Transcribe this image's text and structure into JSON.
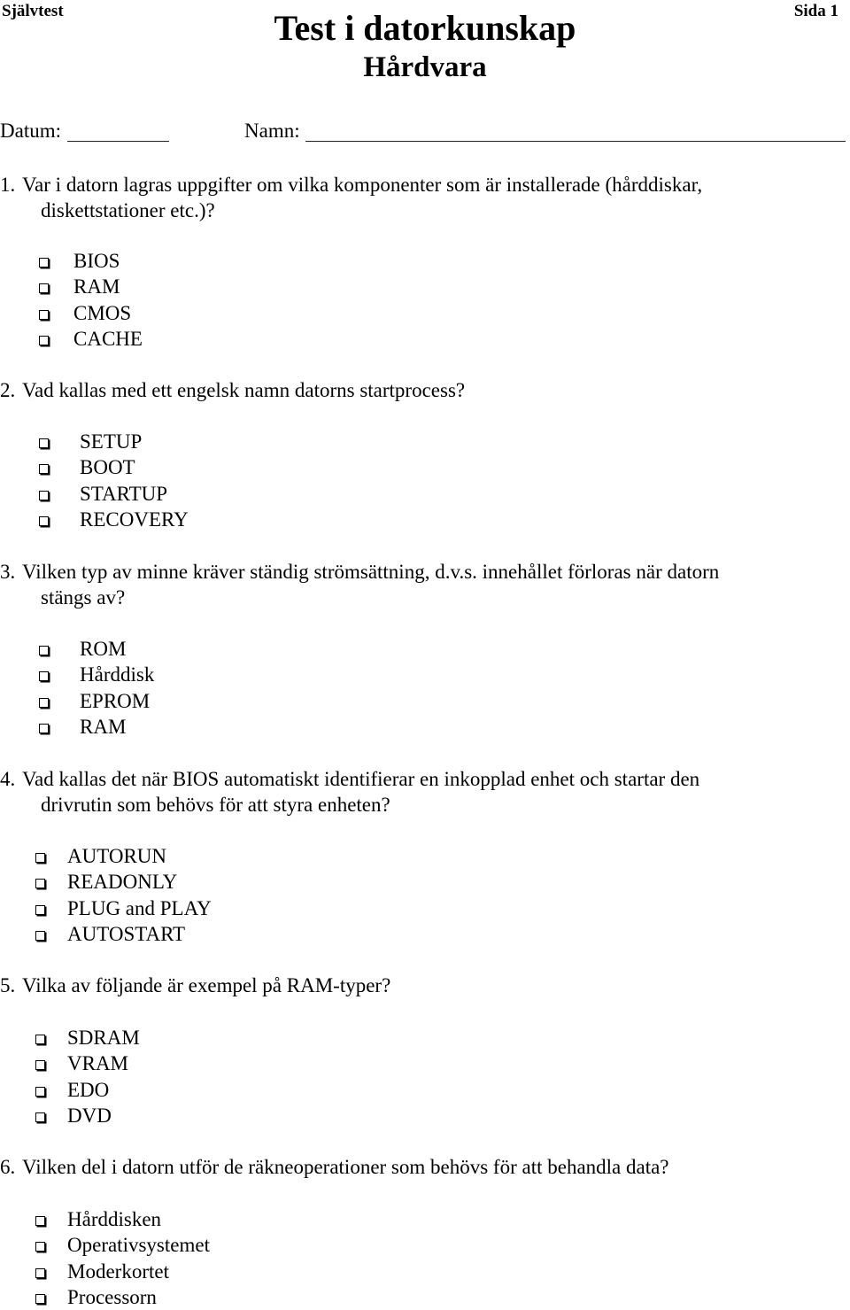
{
  "header": {
    "left_label": "Självtest",
    "right_label": "Sida 1",
    "title": "Test i datorkunskap",
    "subtitle": "Hårdvara"
  },
  "fields": {
    "date_label": "Datum:",
    "date_value": "",
    "name_label": "Namn:",
    "name_value": ""
  },
  "questions": [
    {
      "number": "1.",
      "text_line1": "Var i datorn lagras uppgifter om vilka komponenter som är installerade (hårddiskar,",
      "text_line2": "diskettstationer etc.)?",
      "options": [
        "BIOS",
        "RAM",
        "CMOS",
        "CACHE"
      ]
    },
    {
      "number": "2.",
      "text_line1": "Vad kallas med ett engelsk namn datorns startprocess?",
      "text_line2": "",
      "options": [
        "SETUP",
        "BOOT",
        "STARTUP",
        "RECOVERY"
      ]
    },
    {
      "number": "3.",
      "text_line1": "Vilken typ av minne kräver ständig strömsättning, d.v.s. innehållet förloras när datorn",
      "text_line2": "stängs av?",
      "options": [
        "ROM",
        "Hårddisk",
        "EPROM",
        "RAM"
      ]
    },
    {
      "number": "4.",
      "text_line1": "Vad kallas det när BIOS automatiskt identifierar en inkopplad enhet och startar den",
      "text_line2": "drivrutin som behövs för att styra enheten?",
      "options": [
        "AUTORUN",
        "READONLY",
        "PLUG and PLAY",
        "AUTOSTART"
      ]
    },
    {
      "number": "5.",
      "text_line1": "Vilka av följande är exempel på RAM-typer?",
      "text_line2": "",
      "options": [
        "SDRAM",
        "VRAM",
        "EDO",
        "DVD"
      ]
    },
    {
      "number": "6.",
      "text_line1": "Vilken del i datorn utför de räkneoperationer som behövs för att behandla data?",
      "text_line2": "",
      "options": [
        "Hårddisken",
        "Operativsystemet",
        "Moderkortet",
        "Processorn"
      ]
    }
  ],
  "icons": {
    "checkbox": "checkbox-icon"
  }
}
